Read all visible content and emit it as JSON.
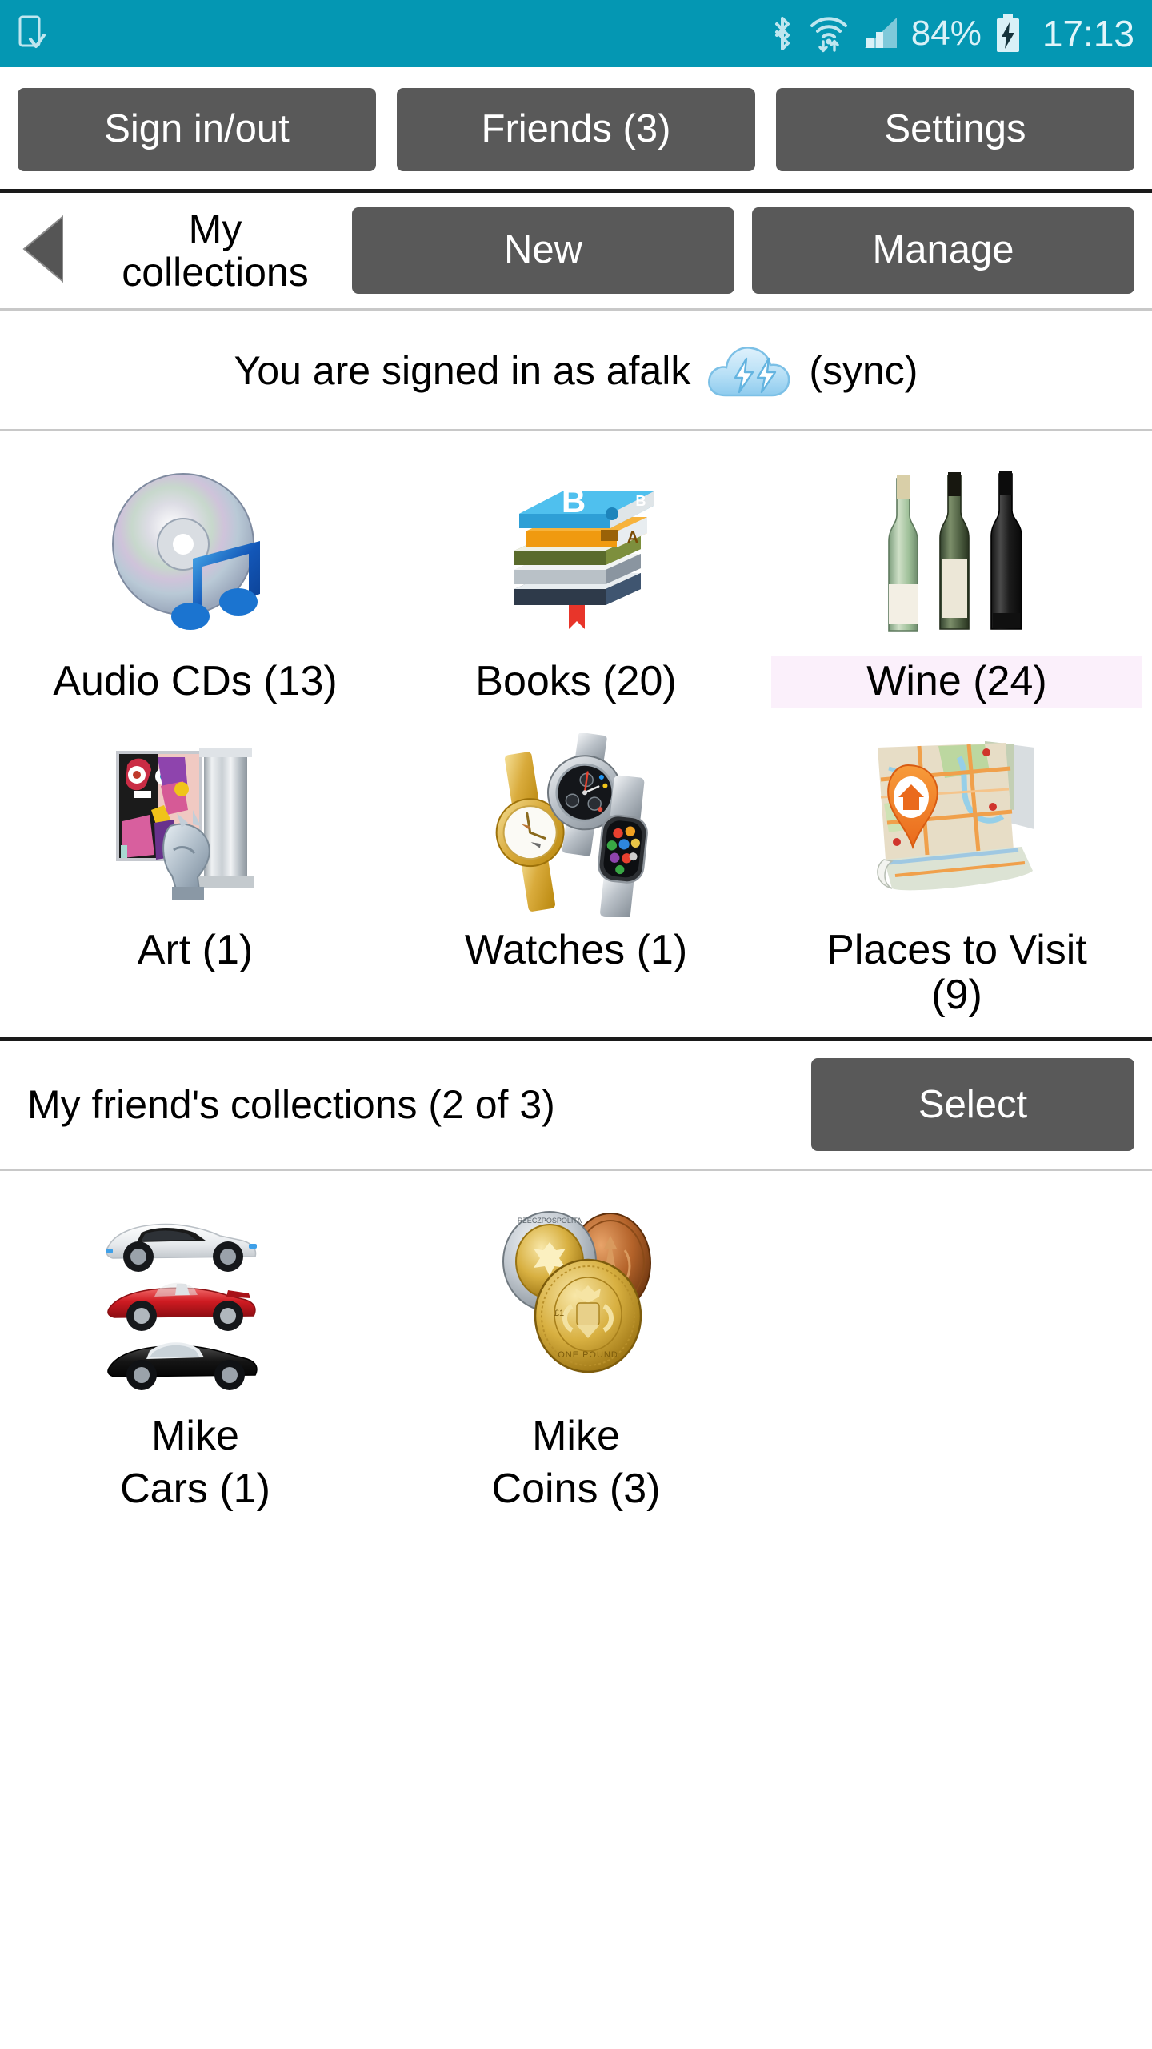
{
  "statusbar": {
    "battery_percent": "84%",
    "time": "17:13",
    "icons": [
      "document-check-icon",
      "bluetooth-icon",
      "wifi-icon",
      "cellular-signal-icon",
      "battery-charging-icon"
    ],
    "background_color": "#0497b3",
    "foreground_color": "#d9f1f7"
  },
  "toolbar": {
    "sign_in_out_label": "Sign in/out",
    "friends_label": "Friends (3)",
    "settings_label": "Settings"
  },
  "nav": {
    "back_icon": "back-triangle-icon",
    "title": "My\ncollections",
    "new_label": "New",
    "manage_label": "Manage"
  },
  "account": {
    "status_text": "You are signed in as afalk",
    "sync_icon": "cloud-sync-icon",
    "sync_label": "(sync)"
  },
  "my_collections": [
    {
      "label": "Audio CDs (13)",
      "icon": "audio-cd-icon",
      "highlighted": false
    },
    {
      "label": "Books (20)",
      "icon": "books-stack-icon",
      "highlighted": false
    },
    {
      "label": "Wine (24)",
      "icon": "wine-bottles-icon",
      "highlighted": true
    },
    {
      "label": "Art (1)",
      "icon": "art-painting-icon",
      "highlighted": false
    },
    {
      "label": "Watches (1)",
      "icon": "watches-icon",
      "highlighted": false
    },
    {
      "label": "Places to Visit\n(9)",
      "icon": "map-pin-icon",
      "highlighted": false
    }
  ],
  "friends_section": {
    "title": "My friend's collections (2 of 3)",
    "select_label": "Select",
    "collections": [
      {
        "owner": "Mike",
        "label": "Cars (1)",
        "icon": "cars-icon"
      },
      {
        "owner": "Mike",
        "label": "Coins (3)",
        "icon": "coins-icon"
      }
    ]
  },
  "colors": {
    "accent_teal": "#0497b3",
    "button_gray": "#595959",
    "highlight_pink": "#fbf0fb"
  }
}
